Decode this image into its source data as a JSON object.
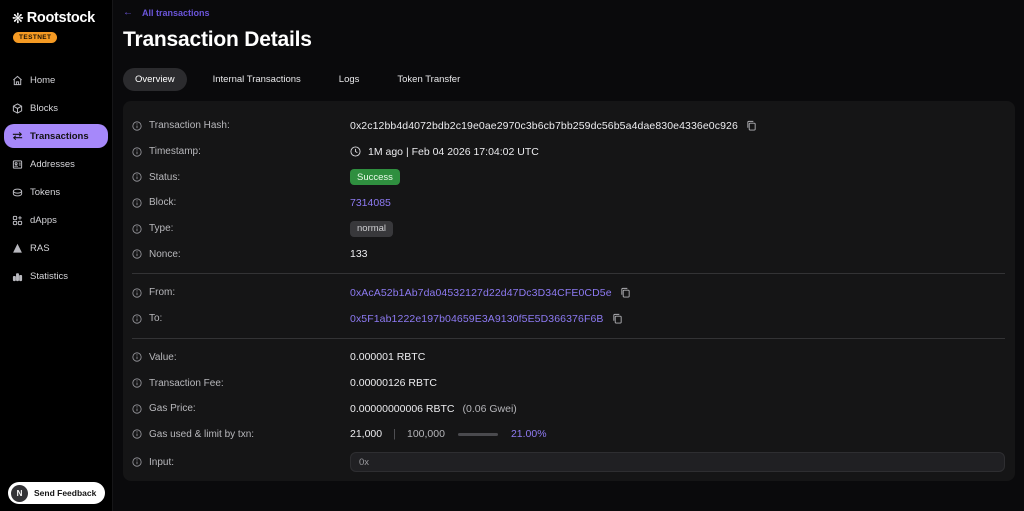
{
  "sidebar": {
    "logo_text": "Rootstock",
    "logo_glyph": "❋",
    "network_badge": "TESTNET",
    "items": [
      {
        "label": "Home"
      },
      {
        "label": "Blocks"
      },
      {
        "label": "Transactions"
      },
      {
        "label": "Addresses"
      },
      {
        "label": "Tokens"
      },
      {
        "label": "dApps"
      },
      {
        "label": "RAS"
      },
      {
        "label": "Statistics"
      }
    ],
    "active_item": "Transactions",
    "feedback": {
      "label": "Send Feedback",
      "avatar_letter": "N"
    }
  },
  "header": {
    "back_arrow": "←",
    "back_link": "All transactions",
    "title": "Transaction Details"
  },
  "tabs": {
    "overview": "Overview",
    "internal": "Internal Transactions",
    "logs": "Logs",
    "token_transfer": "Token Transfer",
    "active": "Overview"
  },
  "details": {
    "transaction_hash": {
      "label": "Transaction Hash:",
      "value": "0x2c12bb4d4072bdb2c19e0ae2970c3b6cb7bb259dc56b5a4dae830e4336e0c926"
    },
    "timestamp": {
      "label": "Timestamp:",
      "value": "1M ago | Feb 04 2026 17:04:02 UTC"
    },
    "status": {
      "label": "Status:",
      "value": "Success"
    },
    "block": {
      "label": "Block:",
      "value": "7314085"
    },
    "type": {
      "label": "Type:",
      "value": "normal"
    },
    "nonce": {
      "label": "Nonce:",
      "value": "133"
    },
    "from": {
      "label": "From:",
      "value": "0xAcA52b1Ab7da04532127d22d47Dc3D34CFE0CD5e"
    },
    "to": {
      "label": "To:",
      "value": "0x5F1ab1222e197b04659E3A9130f5E5D366376F6B"
    },
    "value": {
      "label": "Value:",
      "value": "0.000001 RBTC"
    },
    "transaction_fee": {
      "label": "Transaction Fee:",
      "value": "0.00000126 RBTC"
    },
    "gas_price": {
      "label": "Gas Price:",
      "value": "0.00000000006 RBTC",
      "note": "(0.06 Gwei)"
    },
    "gas_used": {
      "label": "Gas used & limit by txn:",
      "used": "21,000",
      "limit": "100,000",
      "percent_label": "21.00%",
      "percent_value": 21
    },
    "input": {
      "label": "Input:",
      "value": "0x"
    }
  },
  "colors": {
    "accent_purple": "#8d7af2",
    "active_nav_bg": "#a688fa",
    "success_green": "#2f8f3f",
    "testnet_orange": "#f59a23",
    "card_bg": "#151516",
    "sidebar_bg": "#000000"
  }
}
